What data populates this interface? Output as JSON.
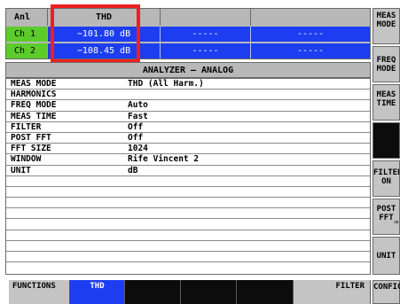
{
  "top_table": {
    "header": {
      "col1": "Anl",
      "col2": "THD"
    },
    "rows": [
      {
        "channel": "Ch 1",
        "value": "−101.80 dB",
        "dash1": "-----",
        "dash2": "-----"
      },
      {
        "channel": "Ch 2",
        "value": "−108.45 dB",
        "dash1": "-----",
        "dash2": "-----"
      }
    ]
  },
  "panel": {
    "title": "ANALYZER – ANALOG",
    "rows": [
      {
        "label": "MEAS MODE",
        "value": "THD (All Harm.)"
      },
      {
        "label": "HARMONICS",
        "value": ""
      },
      {
        "label": "FREQ MODE",
        "value": "Auto"
      },
      {
        "label": "MEAS TIME",
        "value": "Fast"
      },
      {
        "label": "FILTER",
        "value": "Off"
      },
      {
        "label": "POST FFT",
        "value": "Off"
      },
      {
        "label": "FFT SIZE",
        "value": "1024"
      },
      {
        "label": "WINDOW",
        "value": "Rife Vincent 2"
      },
      {
        "label": "UNIT",
        "value": "dB"
      }
    ]
  },
  "soft_keys": {
    "meas_mode": [
      "MEAS",
      "MODE"
    ],
    "freq_mode": [
      "FREQ",
      "MODE"
    ],
    "meas_time": [
      "MEAS",
      "TIME"
    ],
    "filter_on": [
      "FILTER",
      "ON"
    ],
    "post_fft": [
      "POST",
      "FFT"
    ],
    "post_fft_arrow": "⇒",
    "unit": "UNIT"
  },
  "bottom_keys": {
    "functions": "FUNCTIONS",
    "thd": "THD",
    "filter": "FILTER",
    "config": "CONFIG"
  },
  "colors": {
    "channel_green": "#5ccb2c",
    "value_blue": "#1c3ef0",
    "highlight_red": "#ee1f1f",
    "key_gray": "#c4c4c4",
    "key_dark": "#0c0c0c"
  }
}
